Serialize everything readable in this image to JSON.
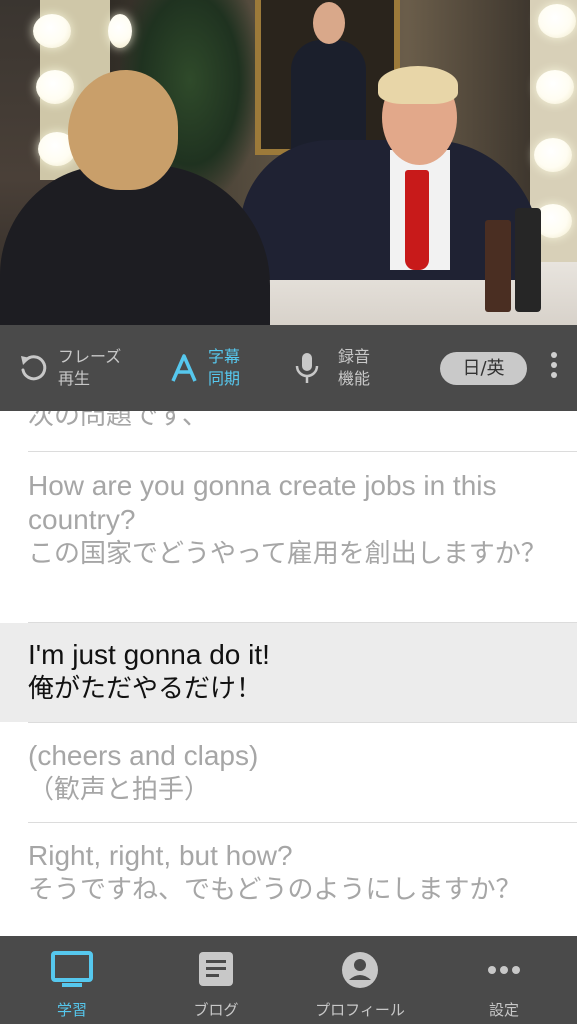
{
  "controls": {
    "phrase_replay_label": "フレーズ\n再生",
    "subtitle_sync_label": "字幕\n同期",
    "recording_label": "録音\n機能",
    "language_toggle": "日/英",
    "more_icon": "more-vertical-icon",
    "accent_color": "#56c8ee"
  },
  "subtitles": [
    {
      "en": "",
      "ja": "次の問題です、",
      "state": "past"
    },
    {
      "en": "How are you gonna create jobs in this country?",
      "ja": "この国家でどうやって雇用を創出しますか？",
      "state": "past"
    },
    {
      "en": "I'm just gonna do it!",
      "ja": "俺がただやるだけ！",
      "state": "current"
    },
    {
      "en": "(cheers and claps)",
      "ja": "（歓声と拍手）",
      "state": "upcoming"
    },
    {
      "en": "Right, right, but how?",
      "ja": "そうですね、でもどうのようにしますか？",
      "state": "upcoming"
    }
  ],
  "tabs": [
    {
      "label": "学習",
      "icon": "monitor-icon",
      "active": true
    },
    {
      "label": "ブログ",
      "icon": "document-icon",
      "active": false
    },
    {
      "label": "プロフィール",
      "icon": "profile-icon",
      "active": false
    },
    {
      "label": "設定",
      "icon": "more-horizontal-icon",
      "active": false
    }
  ]
}
